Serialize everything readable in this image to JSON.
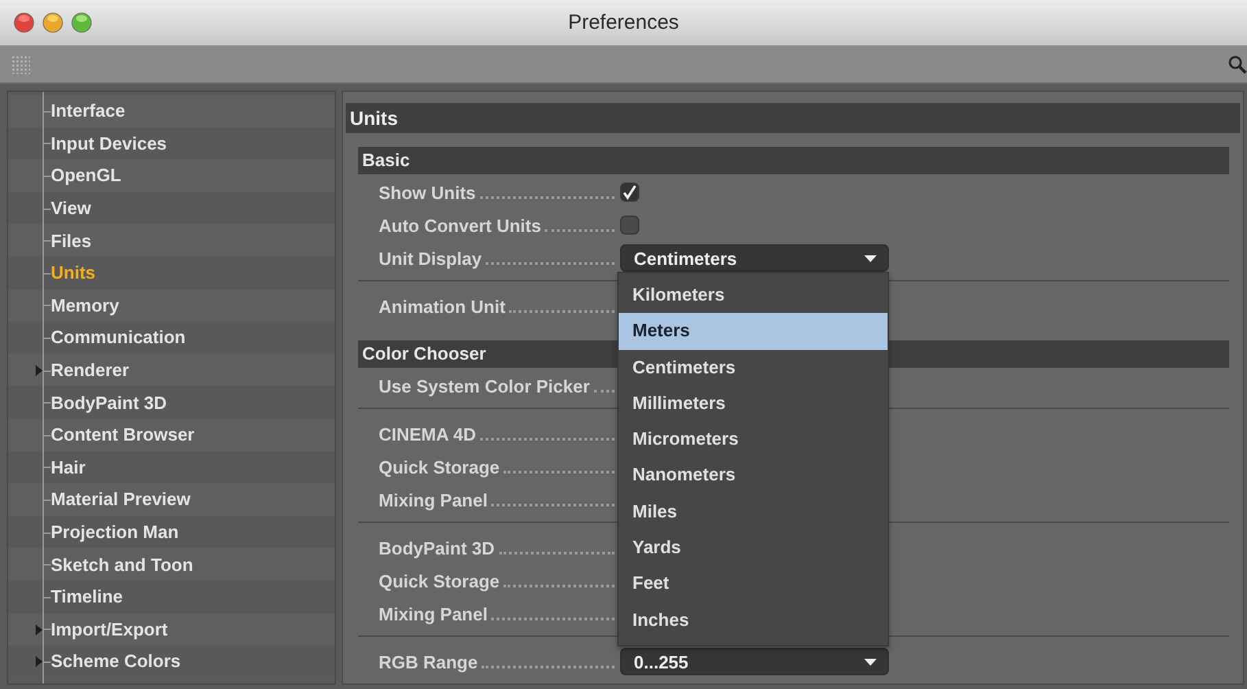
{
  "window": {
    "title": "Preferences"
  },
  "sidebar": {
    "items": [
      {
        "label": "Interface",
        "selected": false,
        "collapsed": false
      },
      {
        "label": "Input Devices",
        "selected": false,
        "collapsed": false
      },
      {
        "label": "OpenGL",
        "selected": false,
        "collapsed": false
      },
      {
        "label": "View",
        "selected": false,
        "collapsed": false
      },
      {
        "label": "Files",
        "selected": false,
        "collapsed": false
      },
      {
        "label": "Units",
        "selected": true,
        "collapsed": false
      },
      {
        "label": "Memory",
        "selected": false,
        "collapsed": false
      },
      {
        "label": "Communication",
        "selected": false,
        "collapsed": false
      },
      {
        "label": "Renderer",
        "selected": false,
        "collapsed": true
      },
      {
        "label": "BodyPaint 3D",
        "selected": false,
        "collapsed": false
      },
      {
        "label": "Content Browser",
        "selected": false,
        "collapsed": false
      },
      {
        "label": "Hair",
        "selected": false,
        "collapsed": false
      },
      {
        "label": "Material Preview",
        "selected": false,
        "collapsed": false
      },
      {
        "label": "Projection Man",
        "selected": false,
        "collapsed": false
      },
      {
        "label": "Sketch and Toon",
        "selected": false,
        "collapsed": false
      },
      {
        "label": "Timeline",
        "selected": false,
        "collapsed": false
      },
      {
        "label": "Import/Export",
        "selected": false,
        "collapsed": true
      },
      {
        "label": "Scheme Colors",
        "selected": false,
        "collapsed": true
      }
    ]
  },
  "panel": {
    "title": "Units",
    "sections": [
      {
        "header": "Basic",
        "blocks": [
          [
            {
              "label": "Show Units",
              "kind": "checkbox",
              "checked": true
            },
            {
              "label": "Auto Convert Units",
              "kind": "checkbox",
              "checked": false
            },
            {
              "label": "Unit Display",
              "kind": "dropdown",
              "value": "Centimeters",
              "menu": {
                "items": [
                  {
                    "label": "Kilometers",
                    "selected": false
                  },
                  {
                    "label": "Meters",
                    "selected": true
                  },
                  {
                    "label": "Centimeters",
                    "selected": false
                  },
                  {
                    "label": "Millimeters",
                    "selected": false
                  },
                  {
                    "label": "Micrometers",
                    "selected": false
                  },
                  {
                    "label": "Nanometers",
                    "selected": false
                  },
                  {
                    "label": "Miles",
                    "selected": false
                  },
                  {
                    "label": "Yards",
                    "selected": false
                  },
                  {
                    "label": "Feet",
                    "selected": false
                  },
                  {
                    "label": "Inches",
                    "selected": false
                  }
                ]
              }
            }
          ],
          [
            {
              "label": "Animation Unit",
              "kind": "label"
            }
          ]
        ]
      },
      {
        "header": "Color Chooser",
        "blocks": [
          [
            {
              "label": "Use System Color Picker",
              "kind": "label"
            }
          ],
          [
            {
              "label": "CINEMA 4D",
              "kind": "label"
            },
            {
              "label": "Quick Storage",
              "kind": "label"
            },
            {
              "label": "Mixing Panel",
              "kind": "label"
            }
          ],
          [
            {
              "label": "BodyPaint 3D",
              "kind": "label"
            },
            {
              "label": "Quick Storage",
              "kind": "label"
            },
            {
              "label": "Mixing Panel",
              "kind": "label"
            }
          ],
          [
            {
              "label": "RGB Range",
              "kind": "dropdown",
              "value": "0...255"
            }
          ]
        ]
      }
    ]
  }
}
